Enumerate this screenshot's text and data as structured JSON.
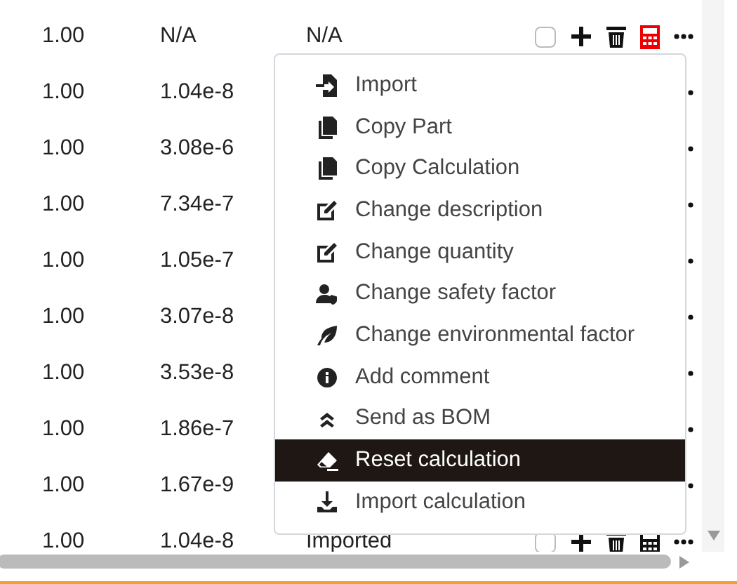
{
  "rows": [
    {
      "kind": "full",
      "quantity": "1.00",
      "value": "N/A",
      "status": "N/A",
      "checked": false,
      "highlighted": true
    },
    {
      "kind": "partial",
      "quantity": "1.00",
      "value": "1.04e-8"
    },
    {
      "kind": "partial",
      "quantity": "1.00",
      "value": "3.08e-6"
    },
    {
      "kind": "partial",
      "quantity": "1.00",
      "value": "7.34e-7"
    },
    {
      "kind": "partial",
      "quantity": "1.00",
      "value": "1.05e-7"
    },
    {
      "kind": "partial",
      "quantity": "1.00",
      "value": "3.07e-8"
    },
    {
      "kind": "partial",
      "quantity": "1.00",
      "value": "3.53e-8"
    },
    {
      "kind": "partial",
      "quantity": "1.00",
      "value": "1.86e-7"
    },
    {
      "kind": "partial",
      "quantity": "1.00",
      "value": "1.67e-9"
    },
    {
      "kind": "full",
      "quantity": "1.00",
      "value": "1.04e-8",
      "status": "Imported",
      "checked": false,
      "highlighted": false
    }
  ],
  "context_menu": {
    "items": [
      {
        "label": "Import",
        "selected": false
      },
      {
        "label": "Copy Part",
        "selected": false
      },
      {
        "label": "Copy Calculation",
        "selected": false
      },
      {
        "label": "Change description",
        "selected": false
      },
      {
        "label": "Change quantity",
        "selected": false
      },
      {
        "label": "Change safety factor",
        "selected": false
      },
      {
        "label": "Change environmental factor",
        "selected": false
      },
      {
        "label": "Add comment",
        "selected": false
      },
      {
        "label": "Send as BOM",
        "selected": false
      },
      {
        "label": "Reset calculation",
        "selected": true
      },
      {
        "label": "Import calculation",
        "selected": false
      }
    ]
  }
}
